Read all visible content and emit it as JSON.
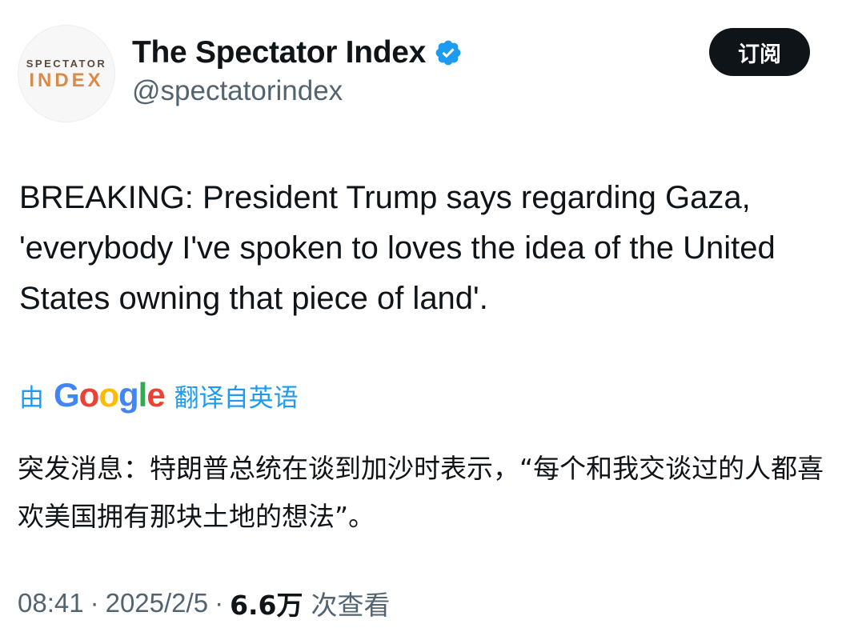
{
  "account": {
    "avatar_logo_top": "SPECTATOR",
    "avatar_logo_bottom": "INDEX",
    "display_name": "The Spectator Index",
    "handle": "@spectatorindex",
    "verified_color": "#1d9bf0"
  },
  "actions": {
    "subscribe_label": "订阅"
  },
  "tweet": {
    "text": "BREAKING: President Trump says regarding Gaza, 'everybody I've spoken to loves the idea of the United States owning that piece of land'.",
    "translation": {
      "by_label": "由",
      "provider_letters": [
        "G",
        "o",
        "o",
        "g",
        "l",
        "e"
      ],
      "from_label": "翻译自英语",
      "text": "突发消息：特朗普总统在谈到加沙时表示，“每个和我交谈过的人都喜欢美国拥有那块土地的想法”。"
    }
  },
  "meta": {
    "time": "08:41",
    "separator": "·",
    "date": "2025/2/5",
    "views_count": "6.6万",
    "views_label": "次查看"
  },
  "colors": {
    "text_primary": "#0f1419",
    "text_secondary": "#536471",
    "link_blue": "#1d9bf0"
  }
}
